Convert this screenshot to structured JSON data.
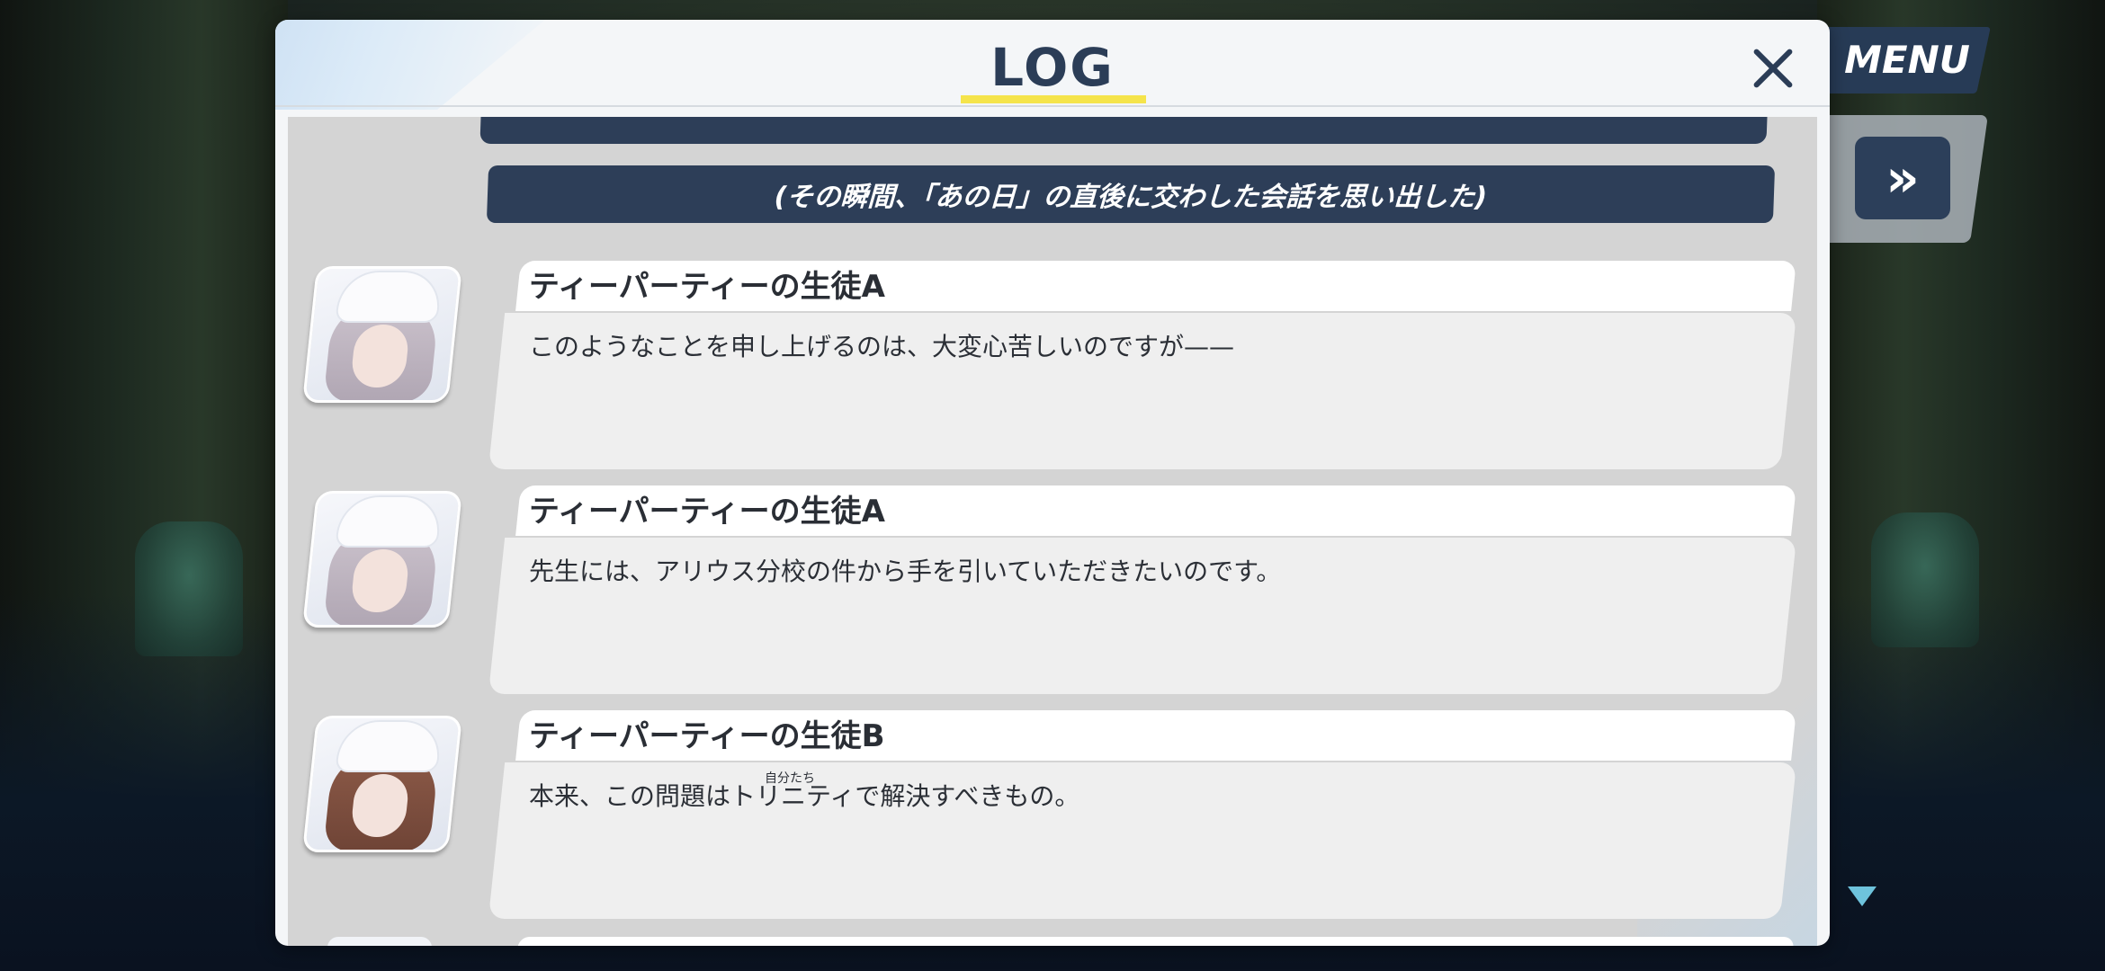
{
  "window": {
    "title": "LOG"
  },
  "hud": {
    "menu_label": "MENU",
    "skip_label": "»",
    "skip_icon": "fast-forward-icon",
    "scroll_indicator_icon": "scroll-down-triangle-icon"
  },
  "log": {
    "narration_top": "(その瞬間、「あの日」の直後に交わした会話を思い出した)",
    "entries": [
      {
        "speaker": "ティーパーティーの生徒A",
        "text": "このようなことを申し上げるのは、大変心苦しいのですが——"
      },
      {
        "speaker": "ティーパーティーの生徒A",
        "text": "先生には、アリウス分校の件から手を引いていただきたいのです。"
      },
      {
        "speaker": "ティーパーティーの生徒B",
        "text": "本来、この問題はトリニティで解決すべきもの。",
        "ruby": "自分たち"
      }
    ]
  },
  "colors": {
    "accent_yellow": "#f5e44b",
    "navy": "#2d3e58",
    "panel_bg": "#f4f6f8",
    "log_bg": "#d4d4d4",
    "card_body": "#efefef",
    "indicator_cyan": "#6ec3dc"
  }
}
